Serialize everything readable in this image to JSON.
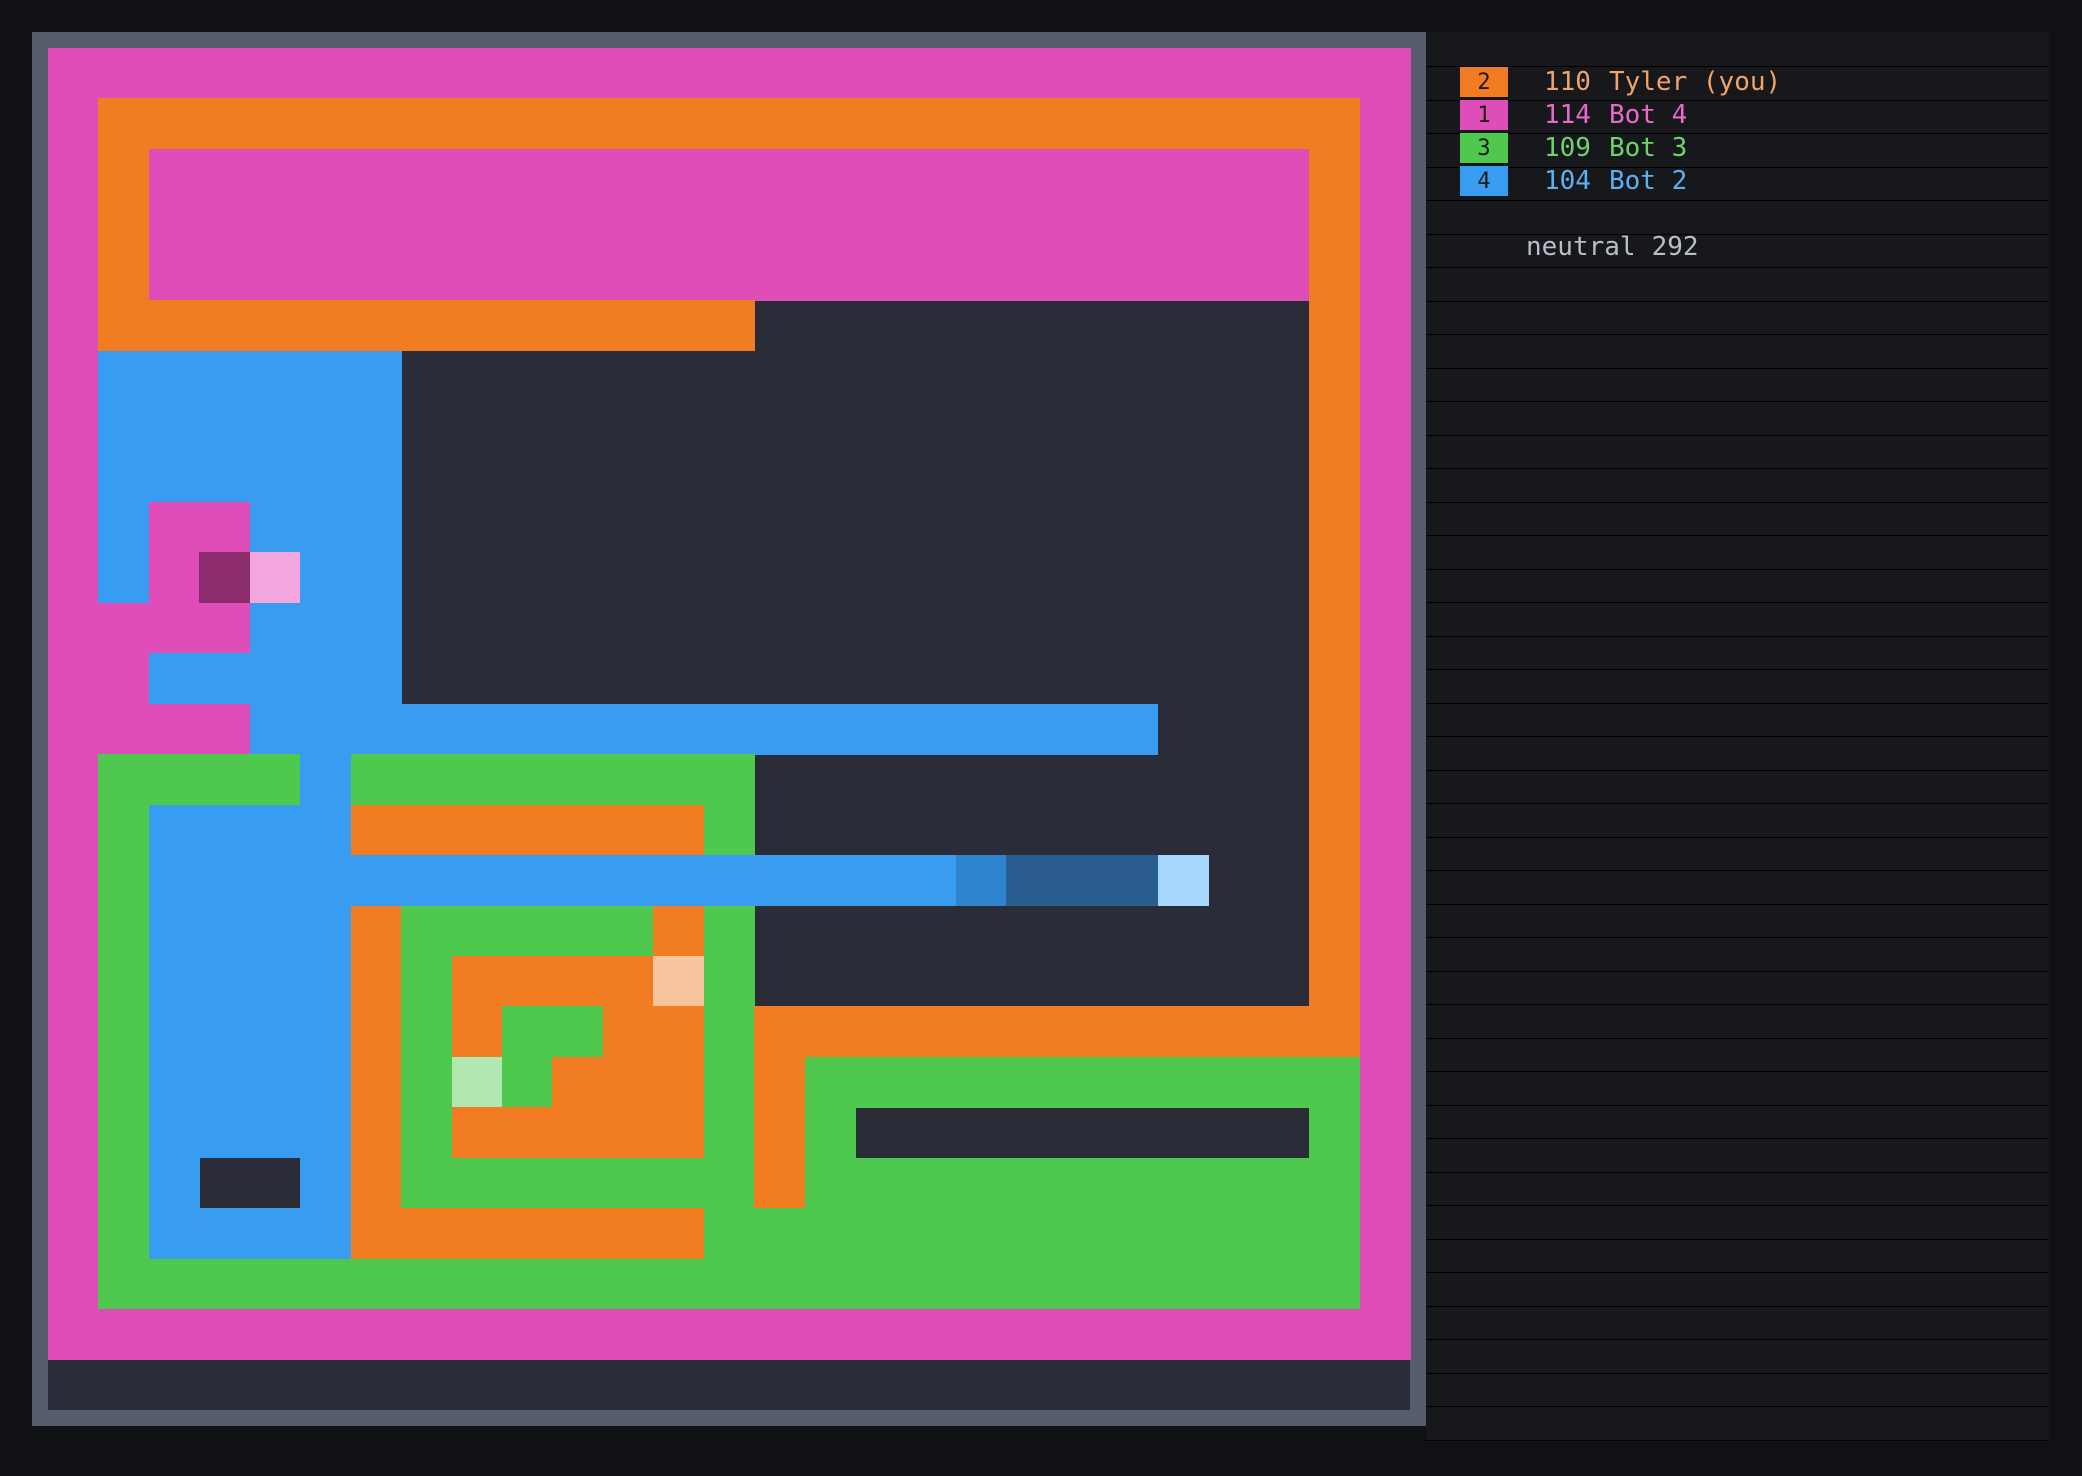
{
  "colors": {
    "background": "#101114",
    "frame": "#545c6e",
    "empty": "#2a2d37",
    "panel": "#17181c"
  },
  "players": [
    {
      "rank": "2",
      "score": "110",
      "name": "Tyler (you)",
      "color": "#f27c22",
      "text_color": "#f3a366"
    },
    {
      "rank": "1",
      "score": "114",
      "name": "Bot 4",
      "color": "#de4db8",
      "text_color": "#e66bc8"
    },
    {
      "rank": "3",
      "score": "109",
      "name": "Bot 3",
      "color": "#4fc94d",
      "text_color": "#6bd46a"
    },
    {
      "rank": "4",
      "score": "104",
      "name": "Bot 2",
      "color": "#389df0",
      "text_color": "#5cb0f2"
    }
  ],
  "neutral": {
    "label": "neutral",
    "count": "292"
  },
  "board": {
    "cols": 27,
    "rows": 27,
    "palette": {
      "P": "#de4db8",
      "O": "#f27c22",
      "B": "#389df0",
      "G": "#4fc94d",
      "D": "#2a2d37",
      "m": "#8c2e6e",
      "p": "#f4a6de",
      "o": "#f9c49d",
      "g": "#b1e7b1",
      "b": "#2e84cf",
      "n": "#2a5e91",
      "l": "#a6d6fc"
    },
    "grid": [
      "PPPPPPPPPPPPPPPPPPPPPPPPPPP",
      "POOOOOOOOOOOOOOOOOOOOOOOOOP",
      "POPPPPPPPPPPPPPPPPPPPPPPPOP",
      "POPPPPPPPPPPPPPPPPPPPPPPPOP",
      "POPPPPPPPPPPPPPPPPPPPPPPPOP",
      "POOOOOOOOOOOOODDDDDDDDDDDOP",
      "PBBBBBBDDDDDDDDDDDDDDDDDDOP",
      "PBBBBBBDDDDDDDDDDDDDDDDDDOP",
      "PBBBBBBDDDDDDDDDDDDDDDDDDOP",
      "PBPPBBBDDDDDDDDDDDDDDDDDDOP",
      "PBPmpBBDDDDDDDDDDDDDDDDDDOP",
      "PPPPBBBDDDDDDDDDDDDDDDDDDOP",
      "PPBBBBBDDDDDDDDDDDDDDDDDDOP",
      "PPPPBBBBBBBBBBBBBBBBBBDDDOP",
      "PGGGGBGGGGGGGGDDDDDDDDDDDOP",
      "PGBBBBOOOOOOOGDDDDDDDDDDDOP",
      "PGBBBBBBBBBBBBBBBBbnnnlDDOP",
      "PGBBBBOGGGGGOGDDDDDDDDDDDOP",
      "PGBBBBOGOOOOoGDDDDDDDDDDDOP",
      "PGBBBBOGOGGOOGOOOOOOOOOOOOP",
      "PGBBBBOGgGOOOGOGGGGGGGGGGGP",
      "PGBBBBOGOOOOOGOGDDDDDDDDDGP",
      "PGBDDBOGGGGGGGOGGGGGGGGGGGP",
      "PGBBBBOOOOOOOGGGGGGGGGGGGGP",
      "PGGGGGGGGGGGGGGGGGGGGGGGGGP",
      "PPPPPPPPPPPPPPPPPPPPPPPPPPP",
      "DDDDDDDDDDDDDDDDDDDDDDDDDDD"
    ]
  }
}
